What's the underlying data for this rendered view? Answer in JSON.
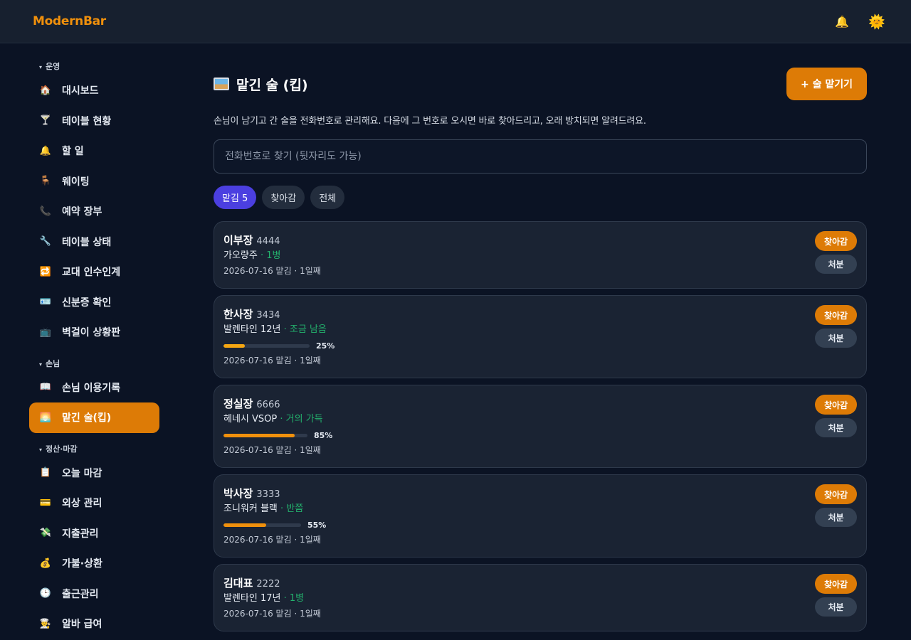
{
  "app": {
    "brand": "ModernBar"
  },
  "topbar": {
    "bell_icon": "🔔",
    "theme_icon": "🌞"
  },
  "sidebar": {
    "sections": [
      {
        "title": "운영",
        "items": [
          {
            "label": "대시보드",
            "icon": "🏠",
            "icon_name": "home-icon"
          },
          {
            "label": "테이블 현황",
            "icon": "🍸",
            "icon_name": "cocktail-icon"
          },
          {
            "label": "할 일",
            "icon": "🔔",
            "icon_name": "bell-icon"
          },
          {
            "label": "웨이팅",
            "icon": "🪑",
            "icon_name": "chair-icon"
          },
          {
            "label": "예약 장부",
            "icon": "📞",
            "icon_name": "phone-icon"
          },
          {
            "label": "테이블 상태",
            "icon": "🔧",
            "icon_name": "wrench-icon"
          },
          {
            "label": "교대 인수인계",
            "icon": "🔁",
            "icon_name": "repeat-icon"
          },
          {
            "label": "신분증 확인",
            "icon": "🪪",
            "icon_name": "id-card-icon"
          },
          {
            "label": "벽걸이 상황판",
            "icon": "📺",
            "icon_name": "tv-icon"
          }
        ]
      },
      {
        "title": "손님",
        "items": [
          {
            "label": "손님 이용기록",
            "icon": "📖",
            "icon_name": "book-icon"
          },
          {
            "label": "맡긴 술(킵)",
            "icon": "🌅",
            "icon_name": "picture-icon",
            "active": true
          }
        ]
      },
      {
        "title": "정산·마감",
        "items": [
          {
            "label": "오늘 마감",
            "icon": "📋",
            "icon_name": "clipboard-icon"
          },
          {
            "label": "외상 관리",
            "icon": "💳",
            "icon_name": "credit-card-icon"
          },
          {
            "label": "지출관리",
            "icon": "💸",
            "icon_name": "money-wings-icon"
          },
          {
            "label": "가불·상환",
            "icon": "💰",
            "icon_name": "money-bag-icon"
          },
          {
            "label": "출근관리",
            "icon": "🕒",
            "icon_name": "clock-icon"
          },
          {
            "label": "알바 급여",
            "icon": "👨‍🍳",
            "icon_name": "cook-icon"
          }
        ]
      }
    ]
  },
  "main": {
    "title": "맡긴 술 (킵)",
    "add_button": "+ 술 맡기기",
    "description": "손님이 남기고 간 술을 전화번호로 관리해요. 다음에 그 번호로 오시면 바로 찾아드리고, 오래 방치되면 알려드려요.",
    "search_placeholder": "전화번호로 찾기 (뒷자리도 가능)",
    "filters": [
      {
        "label": "맡김 5",
        "active": true
      },
      {
        "label": "찾아감",
        "active": false
      },
      {
        "label": "전체",
        "active": false
      }
    ],
    "claim_label": "찾아감",
    "dispose_label": "처분",
    "cards": [
      {
        "name": "이부장",
        "phone": "4444",
        "bottle": "가오량주",
        "status": "· 1병",
        "progress": null,
        "progress_label": null,
        "meta": "2026-07-16 맡김 · 1일째"
      },
      {
        "name": "한사장",
        "phone": "3434",
        "bottle": "발렌타인 12년",
        "status": "· 조금 남음",
        "progress": 0.25,
        "progress_label": "25%",
        "progress_color": "#f5a612",
        "meta": "2026-07-16 맡김 · 1일째"
      },
      {
        "name": "정실장",
        "phone": "6666",
        "bottle": "헤네시 VSOP",
        "status": "· 거의 가득",
        "progress": 0.85,
        "progress_label": "85%",
        "progress_color": "#f0900c",
        "meta": "2026-07-16 맡김 · 1일째"
      },
      {
        "name": "박사장",
        "phone": "3333",
        "bottle": "조니워커 블랙",
        "status": "· 반쯤",
        "progress": 0.55,
        "progress_label": "55%",
        "progress_color": "#f0900c",
        "meta": "2026-07-16 맡김 · 1일째"
      },
      {
        "name": "김대표",
        "phone": "2222",
        "bottle": "발렌타인 17년",
        "status": "· 1병",
        "progress": null,
        "progress_label": null,
        "meta": "2026-07-16 맡김 · 1일째"
      }
    ]
  },
  "colors": {
    "accent": "#dd7b06",
    "chip_active": "#4b3fe0",
    "status_green": "#23b26d",
    "bg": "#0b1324",
    "card_bg": "#1a2333"
  }
}
